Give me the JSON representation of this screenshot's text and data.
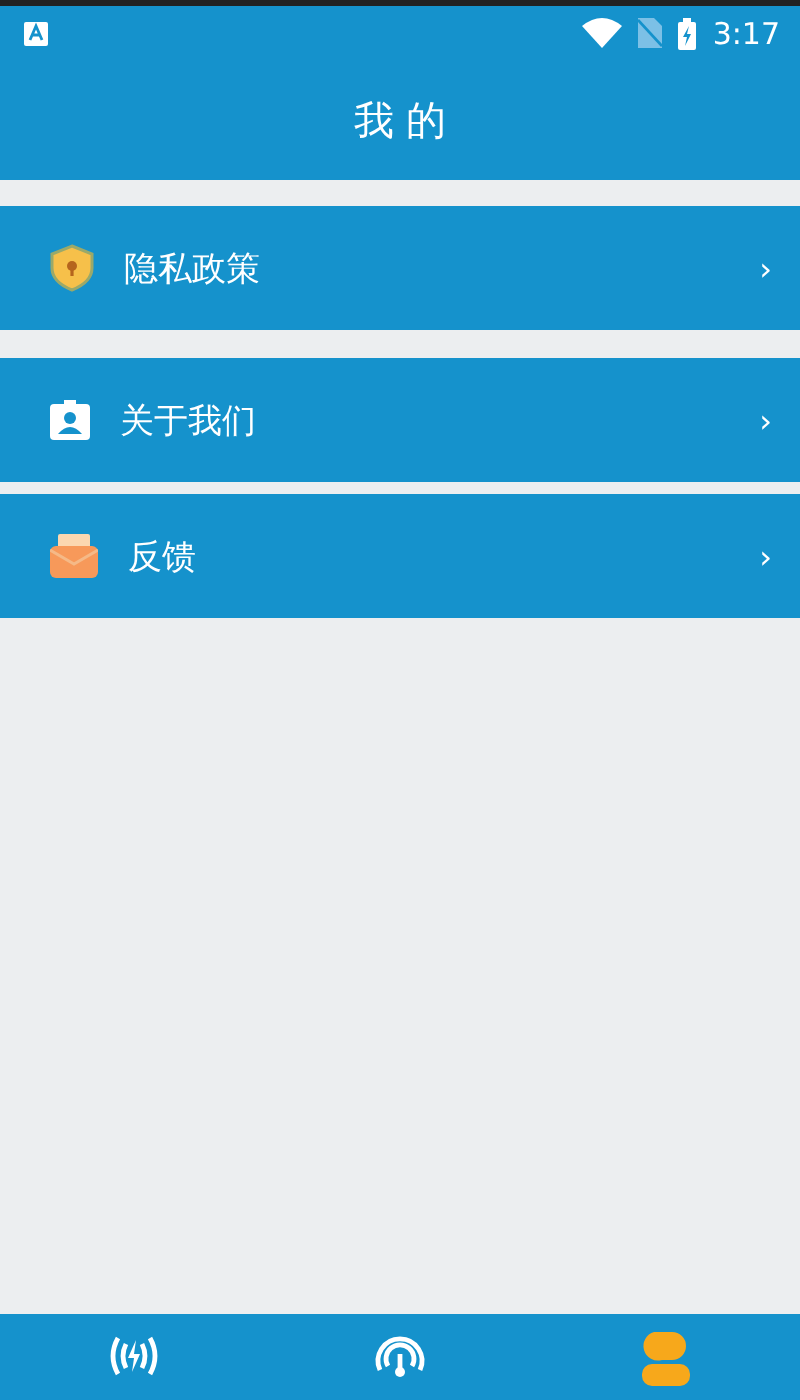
{
  "status_bar": {
    "time": "3:17"
  },
  "header": {
    "title": "我 的"
  },
  "menu": [
    {
      "kind": "shield",
      "label": "隐私政策",
      "arrow": "›"
    },
    {
      "kind": "badge",
      "label": "关于我们",
      "arrow": "›"
    },
    {
      "kind": "mail",
      "label": "反馈",
      "arrow": "›"
    }
  ],
  "bottom_nav": [
    {
      "kind": "sound",
      "selected": false
    },
    {
      "kind": "gauge",
      "selected": false
    },
    {
      "kind": "person",
      "selected": true
    }
  ]
}
